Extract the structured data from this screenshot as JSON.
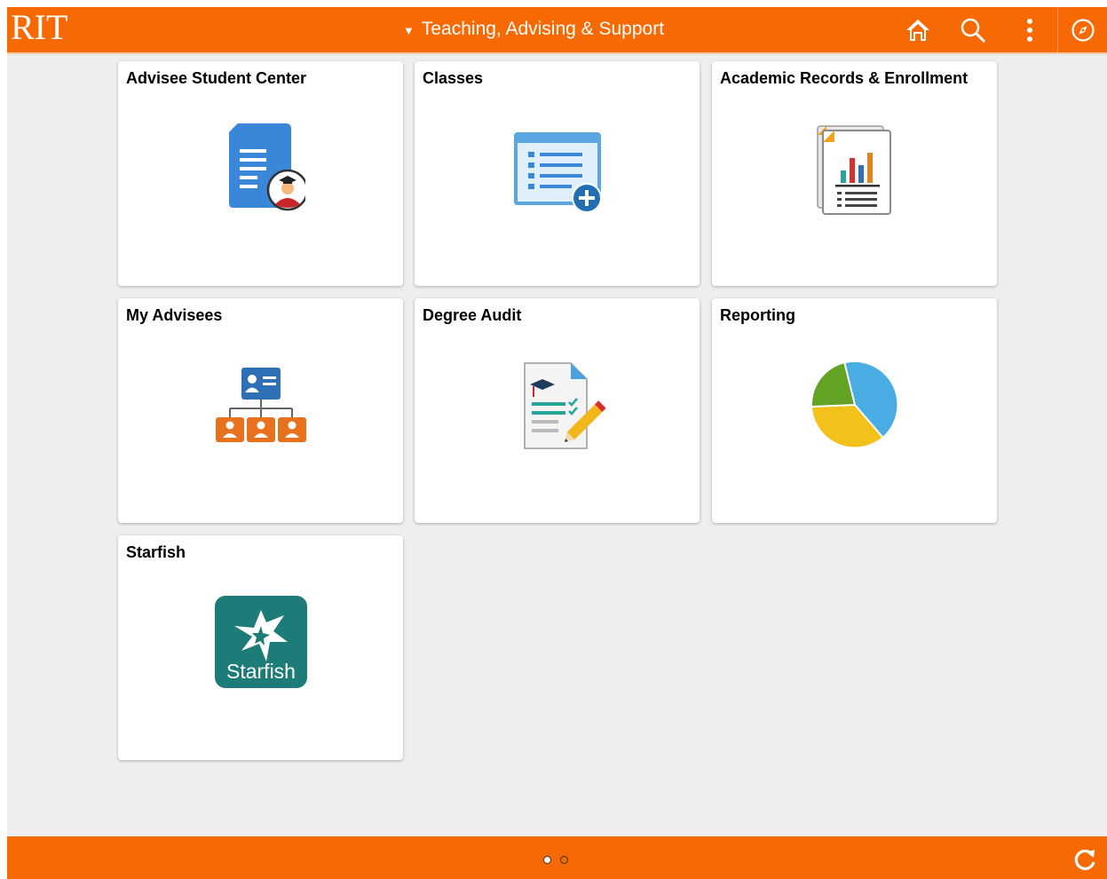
{
  "header": {
    "logo": "RIT",
    "title": "Teaching, Advising & Support",
    "icons": [
      "home-icon",
      "search-icon",
      "more-options-icon",
      "navigator-icon"
    ]
  },
  "tiles": [
    {
      "title": "Advisee Student Center",
      "icon": "advisee-student-center-icon"
    },
    {
      "title": "Classes",
      "icon": "classes-add-list-icon"
    },
    {
      "title": "Academic Records & Enrollment",
      "icon": "academic-records-report-icon"
    },
    {
      "title": "My Advisees",
      "icon": "advisees-org-chart-icon"
    },
    {
      "title": "Degree Audit",
      "icon": "degree-audit-checklist-icon"
    },
    {
      "title": "Reporting",
      "icon": "pie-chart-icon"
    },
    {
      "title": "Starfish",
      "icon": "starfish-logo",
      "logo_text": "Starfish"
    }
  ],
  "footer": {
    "page_count": 2,
    "current_page": 1,
    "refresh_icon": "refresh-icon"
  },
  "colors": {
    "brand_orange": "#f76902",
    "background": "#eeeeee",
    "tile_bg": "#ffffff",
    "starfish_teal": "#1d7b78"
  }
}
